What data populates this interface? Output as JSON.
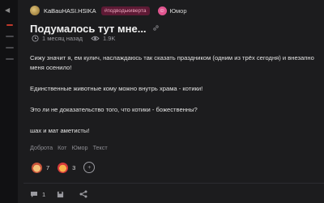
{
  "post": {
    "author": "KaBauHASI.HSIKA",
    "badge": "#подводькиверта",
    "category": "Юмор",
    "title": "Подумалось тут мне...",
    "time_ago": "1 месяц назад",
    "views": "1.9K",
    "paragraphs": [
      "Сижу значит я, ем кулич, наслаждаюсь так сказать праздником (одним из трёх сегодня) и внезапно меня осенило!",
      "Единственные животные кому можно внутрь храма - котики!",
      "Это ли не доказательство того, что котики - божественны?",
      "шах и мат аметисты!"
    ],
    "tags": [
      "Доброта",
      "Кот",
      "Юмор",
      "Текст"
    ],
    "reactions": [
      {
        "icon": "cat-emoji-icon",
        "count": "7"
      },
      {
        "icon": "heart-eyes-emoji-icon",
        "count": "3"
      }
    ],
    "comments_count": "1"
  },
  "colors": {
    "background": "#1c1c1e",
    "badge_bg": "#5e1a35",
    "accent_red": "#c0392b"
  }
}
